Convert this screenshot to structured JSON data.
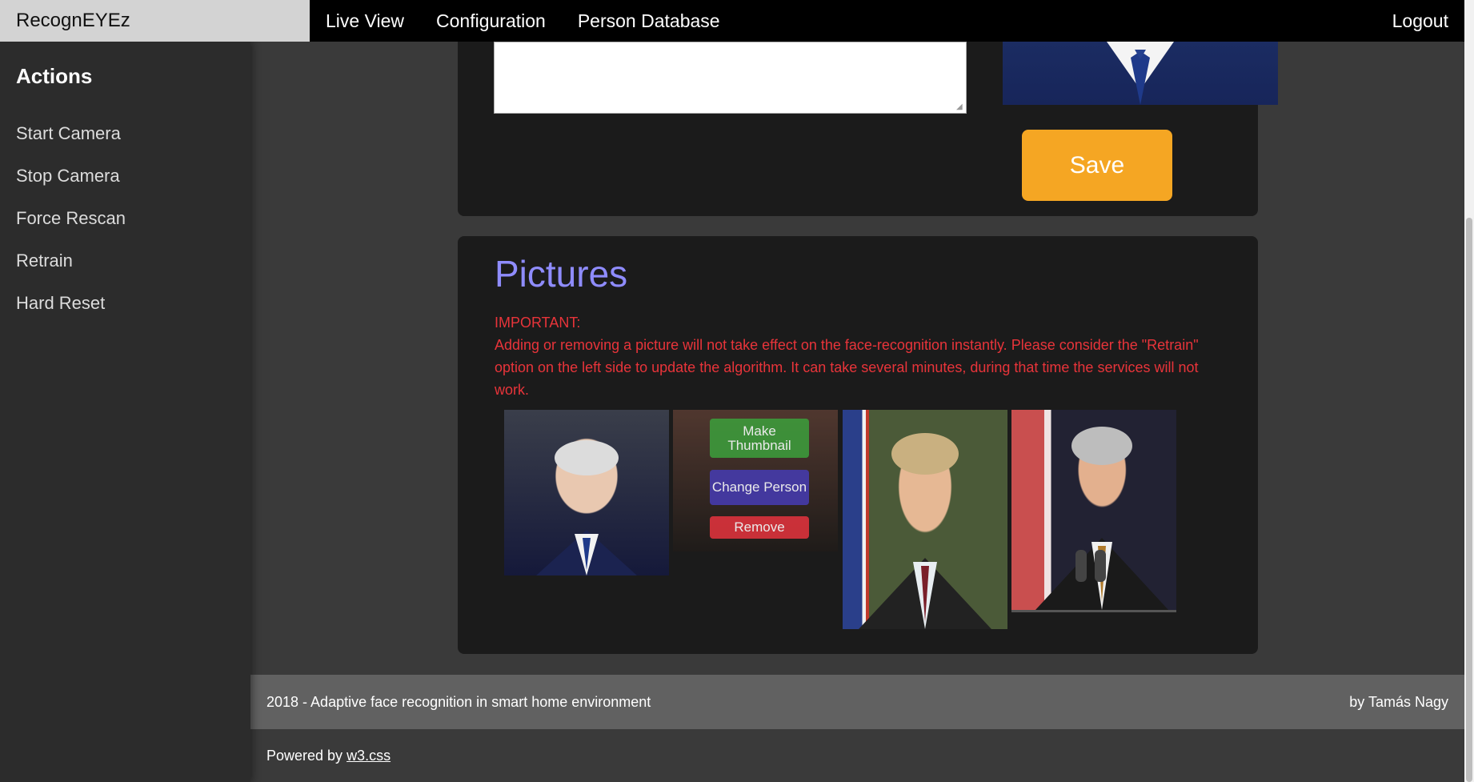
{
  "app": {
    "brand": "RecognEYEz"
  },
  "nav": {
    "items": [
      "Live View",
      "Configuration",
      "Person Database"
    ],
    "logout": "Logout"
  },
  "sidebar": {
    "title": "Actions",
    "items": [
      "Start Camera",
      "Stop Camera",
      "Force Rescan",
      "Retrain",
      "Hard Reset"
    ]
  },
  "person_form": {
    "save_label": "Save"
  },
  "pictures": {
    "title": "Pictures",
    "important_label": "IMPORTANT:",
    "important_text": "Adding or removing a picture will not take effect on the face-recognition instantly. Please consider the \"Retrain\" option on the left side to update the algorithm. It can take several minutes, during that time the services will not work.",
    "overlay": {
      "make_thumbnail": "Make Thumbnail",
      "change_person": "Change Person",
      "remove": "Remove"
    }
  },
  "footer": {
    "left": "2018 - Adaptive face recognition in smart home environment",
    "right": "by Tamás Nagy",
    "powered_prefix": "Powered by ",
    "powered_link": "w3.css"
  },
  "colors": {
    "accent_save": "#f5a623",
    "title_purple": "#8f8cff",
    "warning_red": "#e8343a",
    "btn_green": "#3ca03c",
    "btn_purple": "#463cb4",
    "btn_red": "#dc323c"
  }
}
